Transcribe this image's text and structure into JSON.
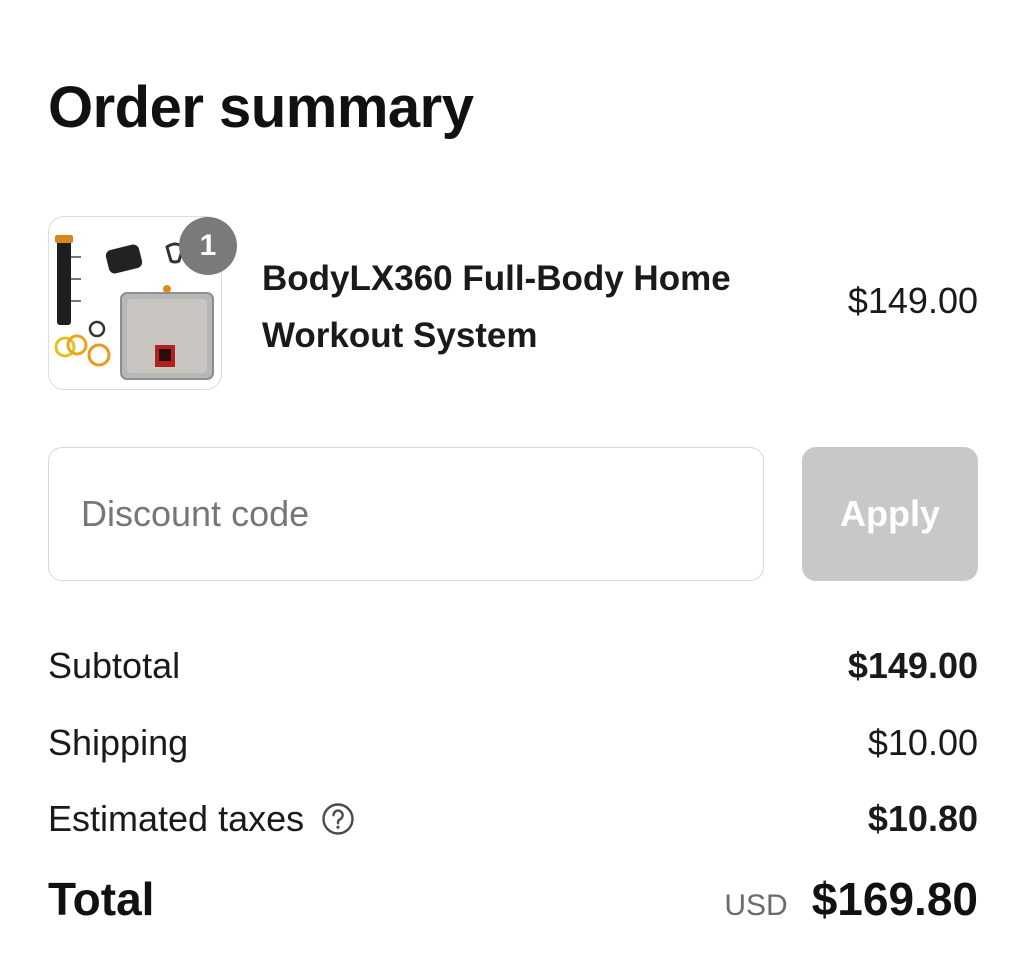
{
  "page": {
    "title": "Order summary"
  },
  "product": {
    "name": "BodyLX360 Full-Body Home Workout System",
    "price": "$149.00",
    "quantity": "1",
    "image_icon": "product-image"
  },
  "discount": {
    "placeholder": "Discount code",
    "value": "",
    "apply_label": "Apply"
  },
  "summary": {
    "subtotal_label": "Subtotal",
    "subtotal_value": "$149.00",
    "shipping_label": "Shipping",
    "shipping_value": "$10.00",
    "taxes_label": "Estimated taxes",
    "taxes_value": "$10.80",
    "taxes_icon": "help-icon",
    "total_label": "Total",
    "currency": "USD",
    "total_value": "$169.80"
  },
  "colors": {
    "badge": "#7a7a7a",
    "apply_disabled": "#c8c8c8",
    "text": "#1a1a1a",
    "muted": "#6b6b6b"
  }
}
